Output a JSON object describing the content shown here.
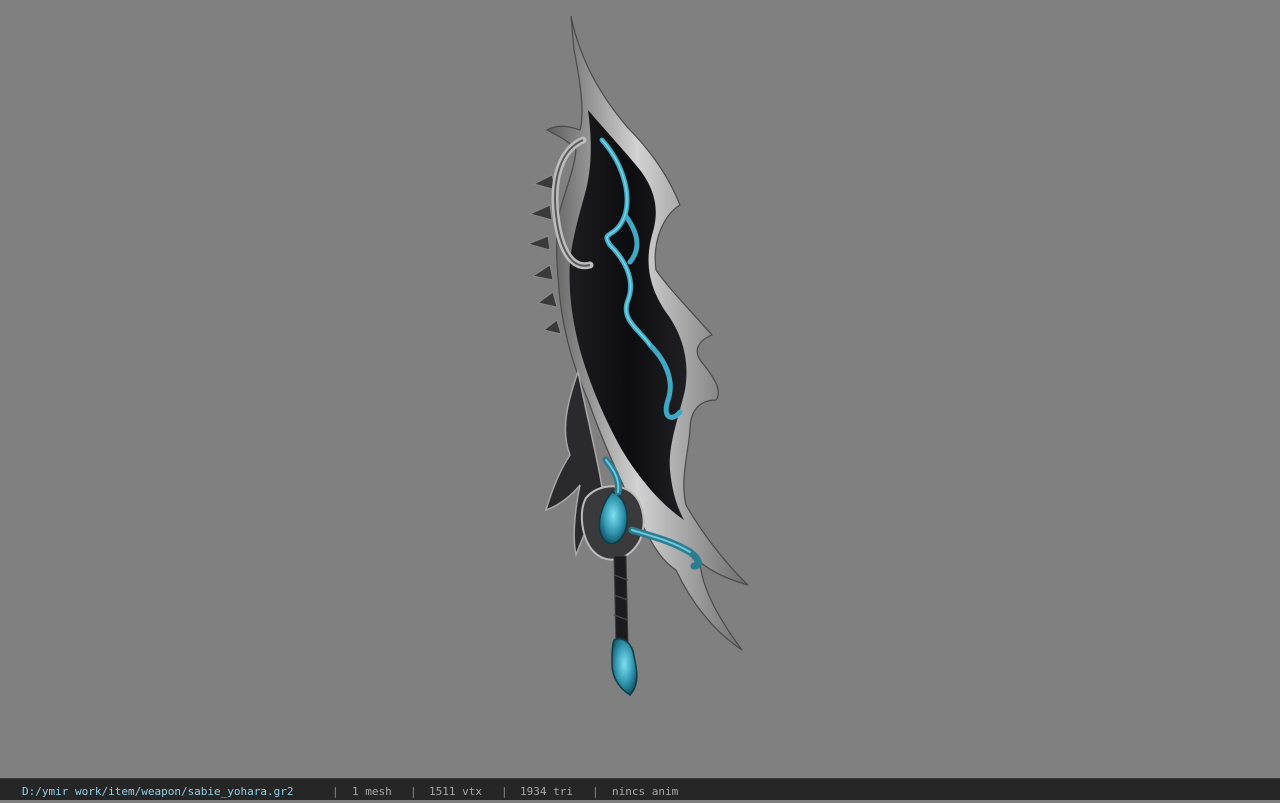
{
  "viewport": {
    "background_color": "#808080",
    "model": {
      "icon": "sword-model",
      "blade_color": "#121214",
      "trim_color": "#a9a9a9",
      "glow_color": "#3fa9c4"
    }
  },
  "statusbar": {
    "file_path": "D:/ymir work/item/weapon/sabie_yohara.gr2",
    "separator": "|",
    "mesh_count": "1 mesh",
    "vertex_count": "1511 vtx",
    "triangle_count": "1934 tri",
    "anim_state": "nincs anim",
    "path_color": "#8fd0e8"
  }
}
